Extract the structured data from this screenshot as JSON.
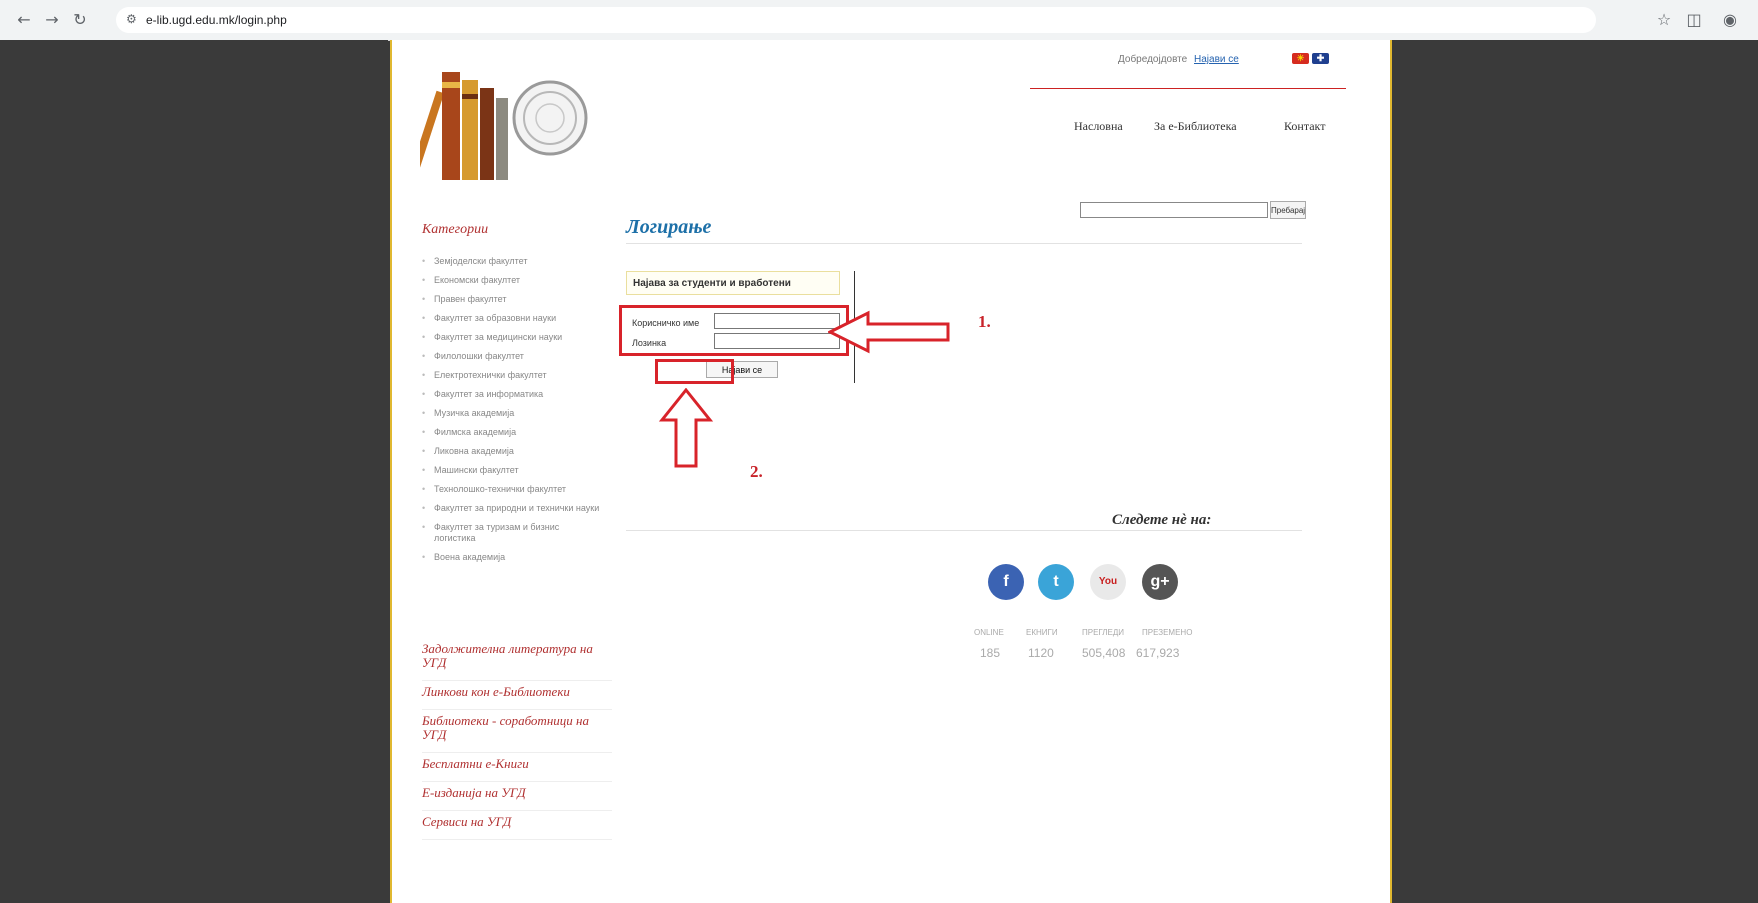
{
  "browser": {
    "url": "e-lib.ugd.edu.mk/login.php",
    "icons": [
      "back-icon",
      "forward-icon",
      "reload-icon",
      "site-settings-icon",
      "star-icon",
      "extensions-icon",
      "profile-icon"
    ]
  },
  "header": {
    "welcome": "Добредојдовте",
    "login_link": "Најави се",
    "nav": [
      "Насловна",
      "За е-Библиотека",
      "Контакт"
    ]
  },
  "search": {
    "button": "Пребарај"
  },
  "sidebar": {
    "title": "Категории",
    "categories": [
      "Земјоделски факултет",
      "Економски факултет",
      "Правен факултет",
      "Факултет за образовни науки",
      "Факултет за медицински науки",
      "Филолошки факултет",
      "Електротехнички факултет",
      "Факултет за информатика",
      "Музичка академија",
      "Филмска академија",
      "Ликовна академија",
      "Машински факултет",
      "Технолошко-технички факултет",
      "Факултет за природни и технички науки",
      "Факултет за туризам и бизнис логистика",
      "Воена академија"
    ],
    "links": [
      "Задолжителна литература на УГД",
      "Линкови кон е-Библиотеки",
      "Библиотеки - соработници на УГД",
      "Бесплатни е-Книги",
      "Е-изданија на УГД",
      "Сервиси на УГД"
    ]
  },
  "main": {
    "title": "Логирање",
    "box_title": "Најава за студенти и вработени",
    "username_label": "Корисничко име",
    "password_label": "Лозинка",
    "button": "Најави се",
    "annot1": "1.",
    "annot2": "2.",
    "follow": "Следете нè на:"
  },
  "social": [
    {
      "name": "facebook",
      "glyph": "f",
      "color": "#3b63b3"
    },
    {
      "name": "twitter",
      "glyph": "t",
      "color": "#3aa4d8"
    },
    {
      "name": "youtube",
      "glyph": "You",
      "color": "#e9e9e9"
    },
    {
      "name": "google-plus",
      "glyph": "g+",
      "color": "#555555"
    }
  ],
  "stats": {
    "labels": [
      "ONLINE",
      "ЕКНИГИ",
      "ПРЕГЛЕДИ",
      "ПРЕЗЕМЕНО"
    ],
    "values": [
      "185",
      "1120",
      "505,408",
      "617,923"
    ]
  },
  "colors": {
    "annotation": "#d8232a",
    "title_blue": "#1d70a8",
    "category_red": "#b03030",
    "border_gold": "#e0b830"
  }
}
